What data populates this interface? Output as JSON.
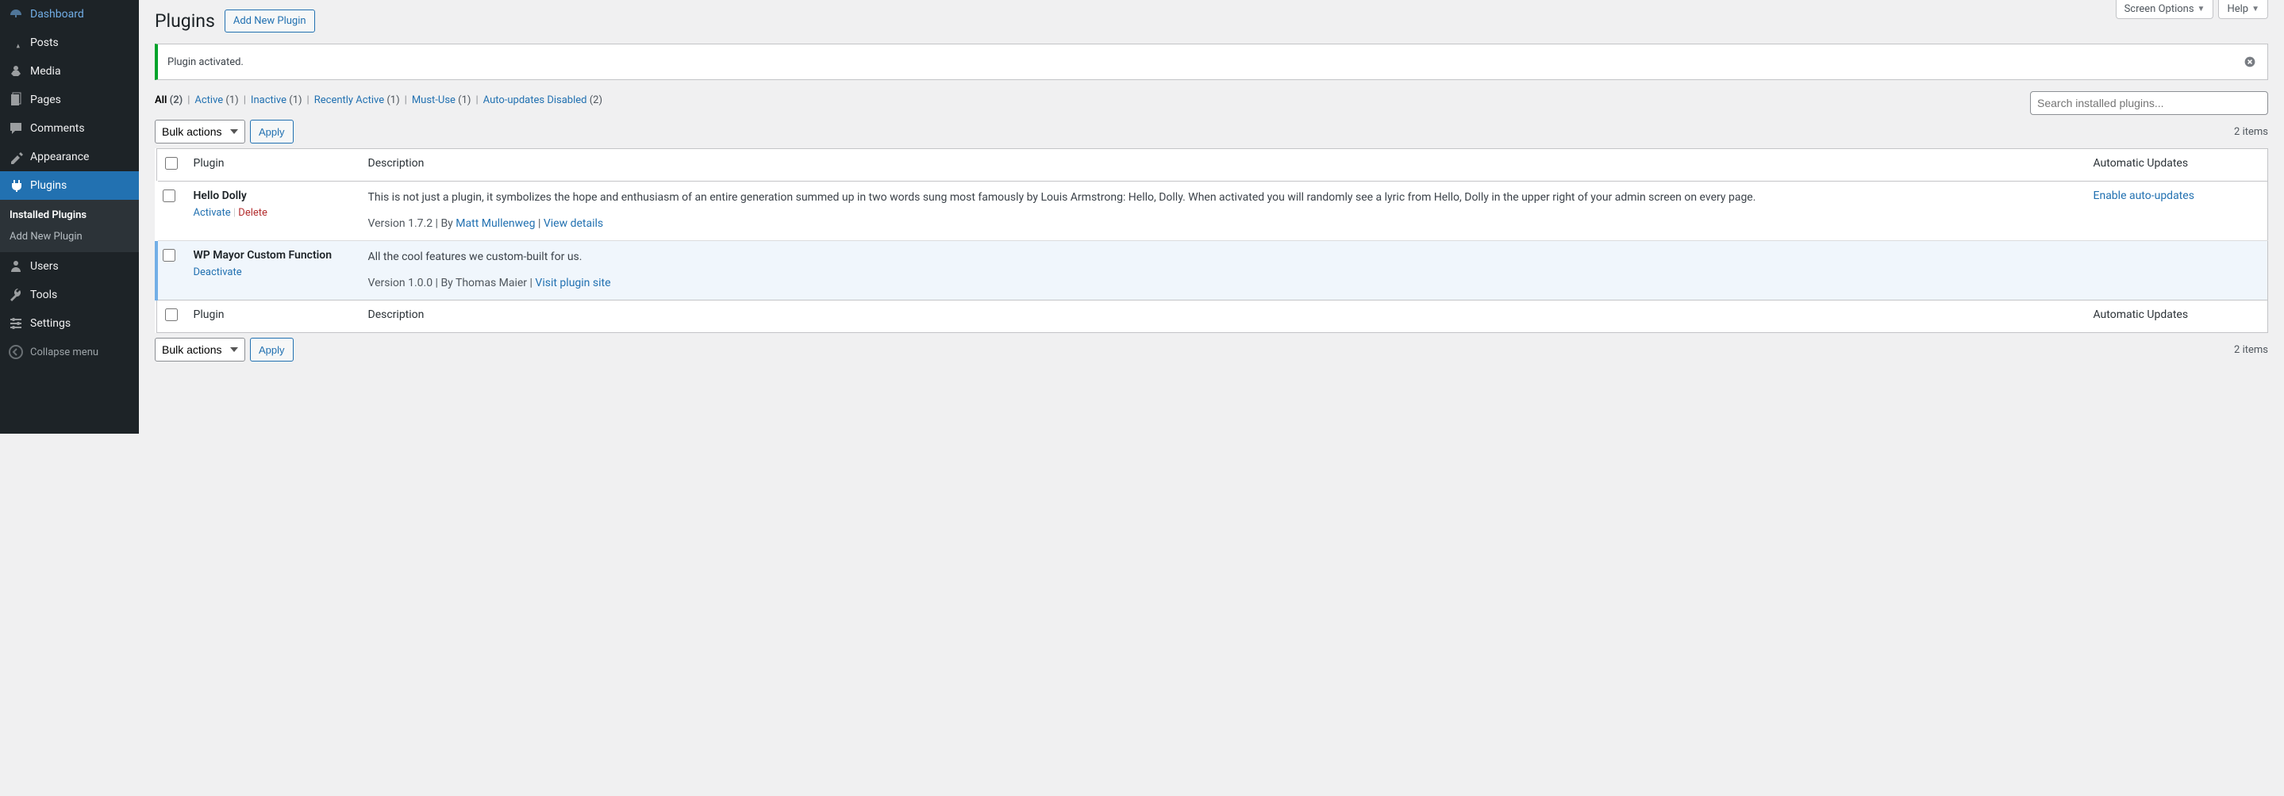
{
  "sidebar": {
    "items": [
      {
        "icon": "dashboard",
        "label": "Dashboard"
      },
      {
        "icon": "pin",
        "label": "Posts"
      },
      {
        "icon": "media",
        "label": "Media"
      },
      {
        "icon": "page",
        "label": "Pages"
      },
      {
        "icon": "comment",
        "label": "Comments"
      },
      {
        "icon": "appearance",
        "label": "Appearance"
      },
      {
        "icon": "plugin",
        "label": "Plugins"
      },
      {
        "icon": "user",
        "label": "Users"
      },
      {
        "icon": "tool",
        "label": "Tools"
      },
      {
        "icon": "settings",
        "label": "Settings"
      }
    ],
    "submenu": [
      "Installed Plugins",
      "Add New Plugin"
    ],
    "collapse": "Collapse menu"
  },
  "top_buttons": {
    "screen_options": "Screen Options",
    "help": "Help"
  },
  "header": {
    "title": "Plugins",
    "add_new": "Add New Plugin"
  },
  "notice": {
    "text": "Plugin activated."
  },
  "filters": [
    {
      "label": "All",
      "count": "(2)",
      "current": true
    },
    {
      "label": "Active",
      "count": "(1)"
    },
    {
      "label": "Inactive",
      "count": "(1)"
    },
    {
      "label": "Recently Active",
      "count": "(1)"
    },
    {
      "label": "Must-Use",
      "count": "(1)"
    },
    {
      "label": "Auto-updates Disabled",
      "count": "(2)"
    }
  ],
  "search": {
    "placeholder": "Search installed plugins..."
  },
  "bulk": {
    "label": "Bulk actions",
    "apply": "Apply"
  },
  "pagination": {
    "items": "2 items"
  },
  "columns": {
    "plugin": "Plugin",
    "description": "Description",
    "auto": "Automatic Updates"
  },
  "rows": [
    {
      "active": false,
      "name": "Hello Dolly",
      "actions": [
        {
          "label": "Activate",
          "class": ""
        },
        {
          "label": "Delete",
          "class": "delete"
        }
      ],
      "desc": "This is not just a plugin, it symbolizes the hope and enthusiasm of an entire generation summed up in two words sung most famously by Louis Armstrong: Hello, Dolly. When activated you will randomly see a lyric from Hello, Dolly in the upper right of your admin screen on every page.",
      "meta_version": "Version 1.7.2",
      "meta_by": "By",
      "meta_author": "Matt Mullenweg",
      "meta_author_link": true,
      "meta_extra": "View details",
      "auto": "Enable auto-updates"
    },
    {
      "active": true,
      "name": "WP Mayor Custom Function",
      "actions": [
        {
          "label": "Deactivate",
          "class": ""
        }
      ],
      "desc": "All the cool features we custom-built for us.",
      "meta_version": "Version 1.0.0",
      "meta_by": "By",
      "meta_author": "Thomas Maier",
      "meta_author_link": false,
      "meta_extra": "Visit plugin site",
      "auto": ""
    }
  ]
}
